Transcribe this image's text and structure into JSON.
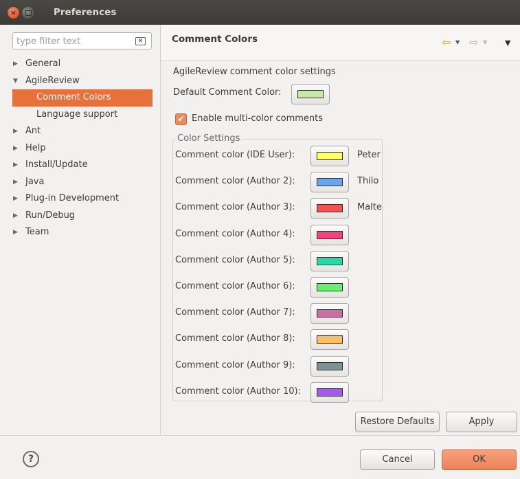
{
  "window": {
    "title": "Preferences"
  },
  "filter": {
    "placeholder": "type filter text",
    "clear_icon": "clear-filter-icon"
  },
  "tree": {
    "items": [
      {
        "label": "General",
        "expanded": false,
        "level": 0
      },
      {
        "label": "AgileReview",
        "expanded": true,
        "level": 0
      },
      {
        "label": "Comment Colors",
        "level": 1,
        "selected": true
      },
      {
        "label": "Language support",
        "level": 1
      },
      {
        "label": "Ant",
        "expanded": false,
        "level": 0
      },
      {
        "label": "Help",
        "expanded": false,
        "level": 0
      },
      {
        "label": "Install/Update",
        "expanded": false,
        "level": 0
      },
      {
        "label": "Java",
        "expanded": false,
        "level": 0
      },
      {
        "label": "Plug-in Development",
        "expanded": false,
        "level": 0
      },
      {
        "label": "Run/Debug",
        "expanded": false,
        "level": 0
      },
      {
        "label": "Team",
        "expanded": false,
        "level": 0
      }
    ]
  },
  "page": {
    "title": "Comment Colors",
    "description": "AgileReview comment color settings",
    "default_color_label": "Default Comment Color:",
    "default_color": "#c6e9a7",
    "multi_color_label": "Enable multi-color comments",
    "multi_color_checked": true,
    "group_title": "Color Settings",
    "rows": [
      {
        "label": "Comment color (IDE User):",
        "color": "#ffff66",
        "name": "Peter"
      },
      {
        "label": "Comment color (Author 2):",
        "color": "#6aa6f0",
        "name": "Thilo"
      },
      {
        "label": "Comment color (Author 3):",
        "color": "#f25252",
        "name": "Malte"
      },
      {
        "label": "Comment color (Author 4):",
        "color": "#f0437f",
        "name": ""
      },
      {
        "label": "Comment color (Author 5):",
        "color": "#2bd7a4",
        "name": ""
      },
      {
        "label": "Comment color (Author 6):",
        "color": "#67ee6f",
        "name": ""
      },
      {
        "label": "Comment color (Author 7):",
        "color": "#c96fa2",
        "name": ""
      },
      {
        "label": "Comment color (Author 8):",
        "color": "#fbbf5e",
        "name": ""
      },
      {
        "label": "Comment color (Author 9):",
        "color": "#7c9196",
        "name": ""
      },
      {
        "label": "Comment color (Author 10):",
        "color": "#a35bea",
        "name": ""
      }
    ],
    "restore_defaults_label": "Restore Defaults",
    "apply_label": "Apply"
  },
  "footer": {
    "cancel_label": "Cancel",
    "ok_label": "OK"
  },
  "colors": {
    "accent": "#e8703a",
    "ok_button": "#ef8b5b",
    "title_bar": "#3c3b37"
  }
}
